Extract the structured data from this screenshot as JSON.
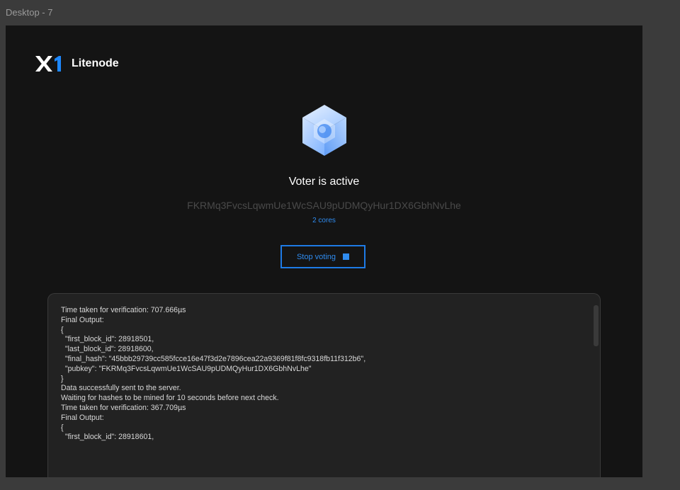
{
  "frame": {
    "label": "Desktop - 7"
  },
  "brand": {
    "logo_text": "X1",
    "name": "Litenode"
  },
  "status": {
    "icon": "cube-icon",
    "title": "Voter is active",
    "pubkey": "FKRMq3FvcsLqwmUe1WcSAU9pUDMQyHur1DX6GbhNvLhe",
    "cores": "2 cores"
  },
  "actions": {
    "stop_label": "Stop voting",
    "stop_icon": "stop-icon"
  },
  "log": {
    "lines": [
      "Time taken for verification: 707.666µs",
      "Final Output:",
      "{",
      "  \"first_block_id\": 28918501,",
      "  \"last_block_id\": 28918600,",
      "  \"final_hash\": \"45bbb29739cc585fcce16e47f3d2e7896cea22a9369f81f8fc9318fb11f312b6\",",
      "  \"pubkey\": \"FKRMq3FvcsLqwmUe1WcSAU9pUDMQyHur1DX6GbhNvLhe\"",
      "}",
      "Data successfully sent to the server.",
      "Waiting for hashes to be mined for 10 seconds before next check.",
      "Time taken for verification: 367.709µs",
      "Final Output:",
      "{",
      "  \"first_block_id\": 28918601,"
    ]
  },
  "colors": {
    "accent": "#2f8cf0",
    "background": "#141414",
    "panel": "#222222"
  }
}
